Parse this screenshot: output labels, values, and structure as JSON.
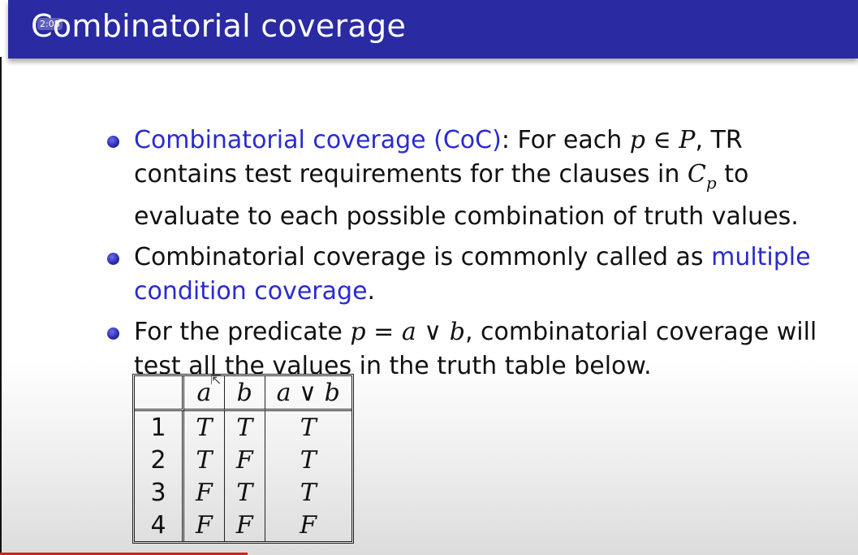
{
  "slide": {
    "title": "Combinatorial coverage",
    "timestamp": "2:08"
  },
  "bullets": [
    {
      "term": "Combinatorial coverage (CoC)",
      "t1": ": For each ",
      "m1": "p",
      "op1": " ∈ ",
      "m2": "P",
      "t2": ", TR contains test requirements for the clauses in ",
      "m3": "C",
      "m3sub": "p",
      "t3": " to evaluate to each possible combination of truth values."
    },
    {
      "t1": "Combinatorial coverage is commonly called as ",
      "term": "multiple condition coverage",
      "t2": "."
    },
    {
      "t1": "For the predicate ",
      "m1": "p",
      "op1": " = ",
      "m2": "a",
      "op2": " ∨ ",
      "m3": "b",
      "t2": ", combinatorial coverage will test all the values in the truth table below."
    }
  ],
  "truth_table": {
    "headers": [
      "",
      "a",
      "b",
      "a ∨ b"
    ],
    "rows": [
      [
        "1",
        "T",
        "T",
        "T"
      ],
      [
        "2",
        "T",
        "F",
        "T"
      ],
      [
        "3",
        "F",
        "T",
        "T"
      ],
      [
        "4",
        "F",
        "F",
        "F"
      ]
    ]
  }
}
